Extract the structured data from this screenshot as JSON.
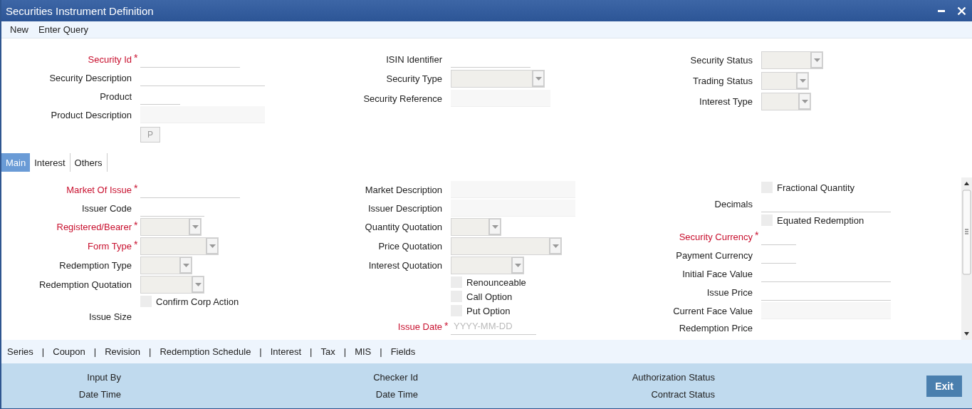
{
  "window": {
    "title": "Securities Instrument Definition"
  },
  "toolbar": [
    "New",
    "Enter Query"
  ],
  "header": {
    "columns": [
      [
        {
          "kind": "text",
          "label": "Security Id",
          "required": true,
          "marker": "*"
        },
        {
          "kind": "text",
          "label": "Security Description",
          "required": false
        },
        {
          "kind": "text",
          "label": "Product",
          "required": false
        },
        {
          "kind": "readonly",
          "label": "Product Description",
          "required": false
        },
        {
          "kind": "button",
          "text": "P"
        }
      ],
      [
        {
          "kind": "text",
          "label": "ISIN Identifier",
          "required": false
        },
        {
          "kind": "select",
          "label": "Security Type",
          "required": false
        },
        {
          "kind": "readonly",
          "label": "Security Reference",
          "required": false
        }
      ],
      [
        {
          "kind": "select",
          "label": "Security Status",
          "required": false
        },
        {
          "kind": "select",
          "label": "Trading Status",
          "required": false
        },
        {
          "kind": "select",
          "label": "Interest Type",
          "required": false
        }
      ]
    ]
  },
  "tabs": [
    {
      "label": "Main",
      "selected": true
    },
    {
      "label": "Interest",
      "selected": false
    },
    {
      "label": "Others",
      "selected": false
    }
  ],
  "main": {
    "columns": [
      [
        {
          "kind": "text",
          "label": "Market Of Issue",
          "required": true,
          "marker": "*"
        },
        {
          "kind": "text",
          "label": "Issuer Code",
          "required": false
        },
        {
          "kind": "select",
          "label": "Registered/Bearer",
          "required": true,
          "marker": "*"
        },
        {
          "kind": "select",
          "label": "Form Type",
          "required": true,
          "marker": "*"
        },
        {
          "kind": "select",
          "label": "Redemption Type",
          "required": false
        },
        {
          "kind": "select",
          "label": "Redemption Quotation",
          "required": false
        },
        {
          "kind": "checkbox",
          "label": "Confirm Corp Action",
          "checked": false
        },
        {
          "kind": "label",
          "label": "Issue Size",
          "required": false
        }
      ],
      [
        {
          "kind": "readonly",
          "label": "Market Description",
          "required": false
        },
        {
          "kind": "readonly",
          "label": "Issuer Description",
          "required": false
        },
        {
          "kind": "select",
          "label": "Quantity Quotation",
          "required": false
        },
        {
          "kind": "select",
          "label": "Price Quotation",
          "required": false
        },
        {
          "kind": "select",
          "label": "Interest Quotation",
          "required": false
        },
        {
          "kind": "checkbox",
          "label": "Renounceable",
          "checked": false
        },
        {
          "kind": "checkbox",
          "label": "Call Option",
          "checked": false
        },
        {
          "kind": "checkbox",
          "label": "Put Option",
          "checked": false
        },
        {
          "kind": "date",
          "label": "Issue Date",
          "required": true,
          "marker": "*",
          "placeholder": "YYYY-MM-DD"
        }
      ],
      [
        {
          "kind": "checkbox",
          "label": "Fractional Quantity",
          "checked": false
        },
        {
          "kind": "text",
          "label": "Decimals",
          "required": false
        },
        {
          "kind": "checkbox",
          "label": "Equated Redemption",
          "checked": false
        },
        {
          "kind": "text",
          "label": "Security Currency",
          "required": true,
          "marker": "*"
        },
        {
          "kind": "text",
          "label": "Payment Currency",
          "required": false
        },
        {
          "kind": "text",
          "label": "Initial Face Value",
          "required": false
        },
        {
          "kind": "text",
          "label": "Issue Price",
          "required": false
        },
        {
          "kind": "readonly",
          "label": "Current Face Value",
          "required": false
        },
        {
          "kind": "label",
          "label": "Redemption Price",
          "required": false
        }
      ]
    ]
  },
  "links": [
    {
      "kind": "link",
      "label": "Series"
    },
    {
      "kind": "separator",
      "label": "|"
    },
    {
      "kind": "link",
      "label": "Coupon"
    },
    {
      "kind": "separator",
      "label": "|"
    },
    {
      "kind": "link",
      "label": "Revision"
    },
    {
      "kind": "separator",
      "label": "|"
    },
    {
      "kind": "link",
      "label": "Redemption Schedule"
    },
    {
      "kind": "separator",
      "label": "|"
    },
    {
      "kind": "link",
      "label": "Interest"
    },
    {
      "kind": "separator",
      "label": "|"
    },
    {
      "kind": "link",
      "label": "Tax"
    },
    {
      "kind": "separator",
      "label": "|"
    },
    {
      "kind": "link",
      "label": "MIS"
    },
    {
      "kind": "separator",
      "label": "|"
    },
    {
      "kind": "link",
      "label": "Fields"
    }
  ],
  "footer": {
    "labels": [
      "Input By",
      "Checker Id",
      "Authorization Status",
      "Date Time",
      "Date Time",
      "Contract Status"
    ],
    "exit_button": "Exit"
  }
}
